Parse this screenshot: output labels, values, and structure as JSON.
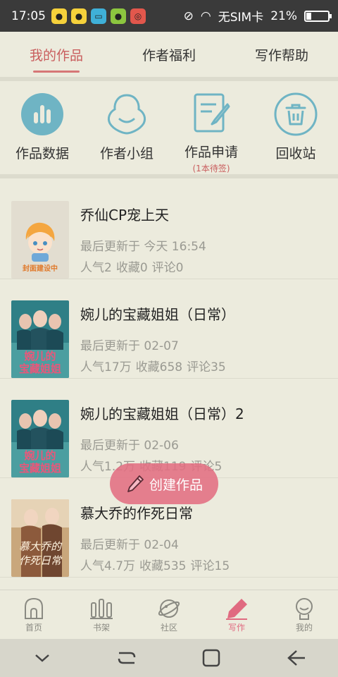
{
  "status": {
    "time": "17:05",
    "carrier": "无SIM卡",
    "battery": "21%",
    "battery_level": 0.21,
    "icons": [
      "qq-icon",
      "qq-icon",
      "bag-icon",
      "wechat-icon",
      "music-icon"
    ]
  },
  "tabs": [
    {
      "label": "我的作品",
      "active": true
    },
    {
      "label": "作者福利",
      "active": false
    },
    {
      "label": "写作帮助",
      "active": false
    }
  ],
  "actions": [
    {
      "label": "作品数据",
      "icon": "bar-chart-icon",
      "sub": ""
    },
    {
      "label": "作者小组",
      "icon": "group-icon",
      "sub": ""
    },
    {
      "label": "作品申请",
      "icon": "edit-doc-icon",
      "sub": "(1本待签)"
    },
    {
      "label": "回收站",
      "icon": "trash-icon",
      "sub": ""
    }
  ],
  "works": [
    {
      "title": "乔仙CP宠上天",
      "updated": "最后更新于 今天 16:54",
      "popularity": "人气2",
      "favorites": "收藏0",
      "comments": "评论0",
      "cover": "placeholder",
      "cover_text": "封面建设中"
    },
    {
      "title": "婉儿的宝藏姐姐（日常）",
      "updated": "最后更新于 02-07",
      "popularity": "人气17万",
      "favorites": "收藏658",
      "comments": "评论35",
      "cover": "image"
    },
    {
      "title": "婉儿的宝藏姐姐（日常）2",
      "updated": "最后更新于 02-06",
      "popularity": "人气1.2万",
      "favorites": "收藏119",
      "comments": "评论5",
      "cover": "image"
    },
    {
      "title": "慕大乔的作死日常",
      "updated": "最后更新于 02-04",
      "popularity": "人气4.7万",
      "favorites": "收藏535",
      "comments": "评论15",
      "cover": "image"
    }
  ],
  "fab": {
    "label": "创建作品",
    "icon": "pencil-icon"
  },
  "bottom_nav": [
    {
      "label": "首页",
      "icon": "home-icon",
      "active": false
    },
    {
      "label": "书架",
      "icon": "bookshelf-icon",
      "active": false
    },
    {
      "label": "社区",
      "icon": "planet-icon",
      "active": false
    },
    {
      "label": "写作",
      "icon": "pen-icon",
      "active": true
    },
    {
      "label": "我的",
      "icon": "profile-icon",
      "active": false
    }
  ],
  "colors": {
    "accent": "#c95e5e",
    "fab": "#e26e82",
    "icon_teal": "#6fb4c4",
    "background": "#ecebdd"
  }
}
